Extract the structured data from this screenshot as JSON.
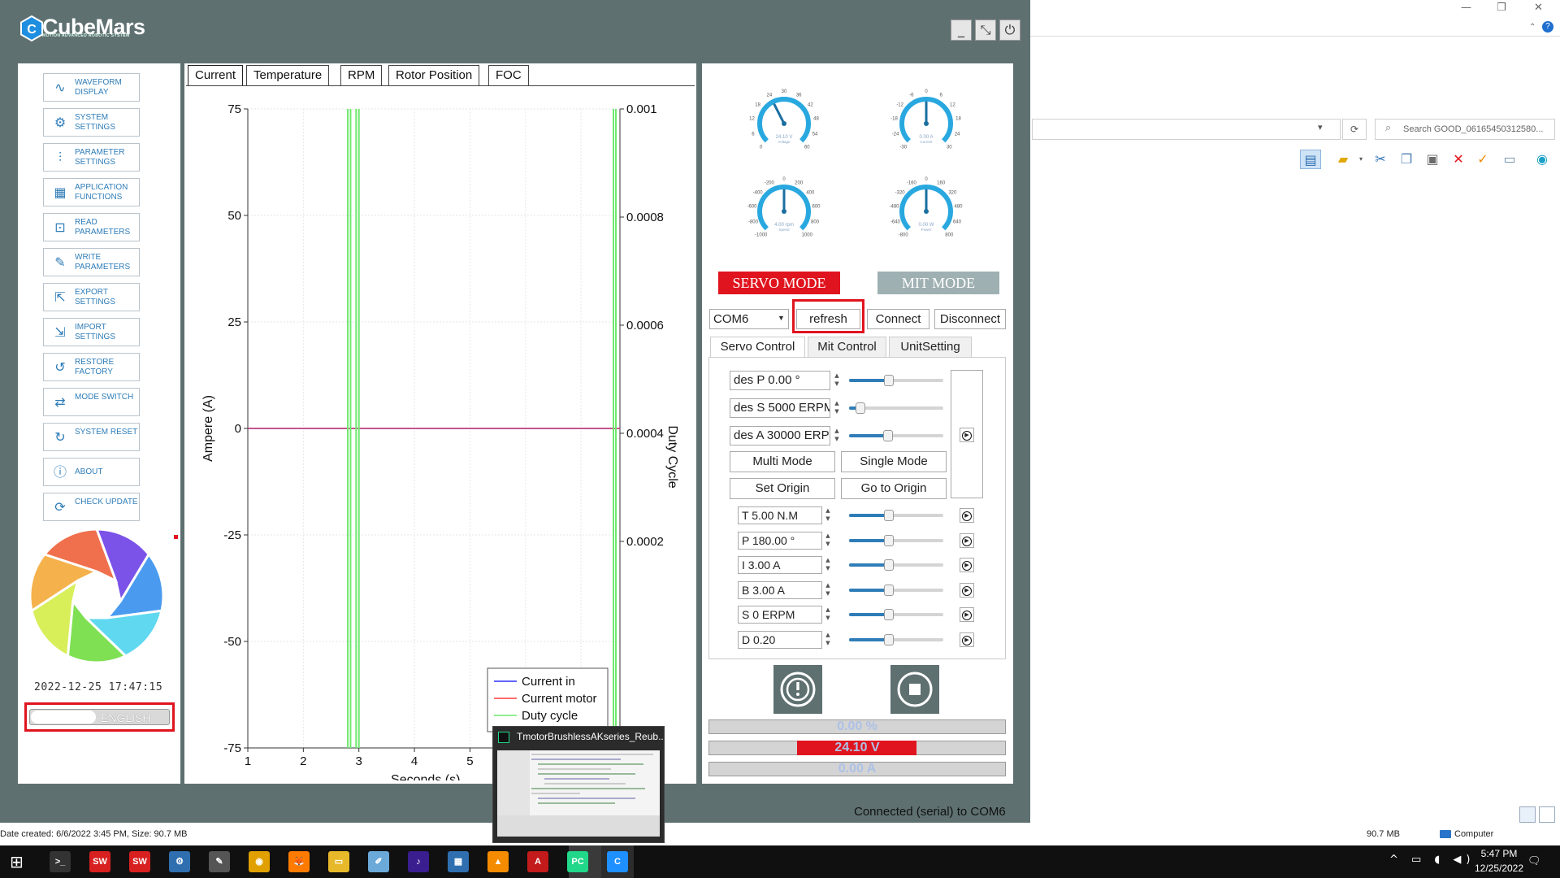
{
  "explorer": {
    "window_controls": [
      "—",
      "❐",
      "✕"
    ],
    "search_placeholder": "Search GOOD_06165450312580...",
    "refresh_glyph": "⟳",
    "status_left": "Date created: 6/6/2022 3:45 PM, Size: 90.7 MB",
    "status_size": "90.7 MB",
    "status_location": "Computer",
    "toolbar_icons": [
      "layout-pane-icon",
      "new-folder-icon",
      "cut-icon",
      "copy-icon",
      "paste-icon",
      "delete-icon",
      "checkmark-icon",
      "rename-icon",
      "globe-icon"
    ]
  },
  "app": {
    "logo_text": "CubeMars",
    "logo_subtitle": "MOTION ADVANCED ROBOTIC SYSTEM",
    "window_buttons": {
      "minimize": "_",
      "maximize": "⤡",
      "power": "⏻"
    },
    "sidebar": [
      {
        "label": "WAVEFORM DISPLAY",
        "icon": "waveform-icon",
        "glyph": "∿"
      },
      {
        "label": "SYSTEM SETTINGS",
        "icon": "gear-icon",
        "glyph": "⚙"
      },
      {
        "label": "PARAMETER SETTINGS",
        "icon": "sliders-icon",
        "glyph": "⫶"
      },
      {
        "label": "APPLICATION FUNCTIONS",
        "icon": "grid-icon",
        "glyph": "▦"
      },
      {
        "label": "READ PARAMETERS",
        "icon": "read-icon",
        "glyph": "⊡"
      },
      {
        "label": "WRITE PARAMETERS",
        "icon": "write-icon",
        "glyph": "✎"
      },
      {
        "label": "EXPORT SETTINGS",
        "icon": "export-icon",
        "glyph": "⇱"
      },
      {
        "label": "IMPORT SETTINGS",
        "icon": "import-icon",
        "glyph": "⇲"
      },
      {
        "label": "RESTORE FACTORY",
        "icon": "restore-icon",
        "glyph": "↺"
      },
      {
        "label": "MODE SWITCH",
        "icon": "switch-icon",
        "glyph": "⇄"
      },
      {
        "label": "SYSTEM RESET",
        "icon": "reset-icon",
        "glyph": "↻"
      },
      {
        "label": "ABOUT",
        "icon": "info-icon",
        "glyph": "ⓘ"
      },
      {
        "label": "CHECK UPDATE",
        "icon": "update-icon",
        "glyph": "⟳"
      }
    ],
    "datetime": "2022-12-25  17:47:15",
    "language": "ENGLISH",
    "tabs": [
      "Current",
      "Temperature",
      "RPM",
      "Rotor Position",
      "FOC"
    ],
    "active_tab": "Current",
    "gauges": [
      {
        "name": "voltage",
        "readout": "24.10 V",
        "caption": "Voltage",
        "ticks": [
          "0",
          "6",
          "12",
          "18",
          "24",
          "30",
          "36",
          "42",
          "48",
          "54",
          "60"
        ],
        "value_fraction": 0.4
      },
      {
        "name": "current",
        "readout": "0.00 A",
        "caption": "Current",
        "ticks": [
          "-30",
          "-24",
          "-18",
          "-12",
          "-6",
          "0",
          "6",
          "12",
          "18",
          "24",
          "30"
        ],
        "value_fraction": 0.5
      },
      {
        "name": "speed",
        "readout": "4.00 rpm",
        "caption": "Speed",
        "ticks": [
          "-1000",
          "-800",
          "-600",
          "-400",
          "-200",
          "0",
          "200",
          "400",
          "600",
          "800",
          "1000"
        ],
        "value_fraction": 0.5
      },
      {
        "name": "power",
        "readout": "0.00 W",
        "caption": "Power",
        "ticks": [
          "-800",
          "-640",
          "-480",
          "-320",
          "-160",
          "0",
          "160",
          "320",
          "480",
          "640",
          "800"
        ],
        "value_fraction": 0.5
      }
    ],
    "mode_buttons": {
      "servo": "SERVO MODE",
      "mit": "MIT MODE"
    },
    "port": {
      "selected": "COM6",
      "refresh": "refresh",
      "connect": "Connect",
      "disconnect": "Disconnect"
    },
    "control_tabs": [
      "Servo Control",
      "Mit Control",
      "UnitSetting"
    ],
    "servo": {
      "des_fields": [
        {
          "value": "des P 0.00 °",
          "slider": 0.42
        },
        {
          "value": "des S 5000 ERPM",
          "slider": 0.12
        },
        {
          "value": "des A 30000 ERPM",
          "slider": 0.41
        }
      ],
      "multi_mode": "Multi Mode",
      "single_mode": "Single Mode",
      "set_origin": "Set Origin",
      "go_to_origin": "Go to Origin",
      "params": [
        {
          "value": "T 5.00 N.M",
          "slider": 0.42
        },
        {
          "value": "P 180.00 °",
          "slider": 0.42
        },
        {
          "value": "I 3.00 A",
          "slider": 0.42
        },
        {
          "value": "B 3.00 A",
          "slider": 0.42
        },
        {
          "value": "S 0 ERPM",
          "slider": 0.42
        },
        {
          "value": "D 0.20",
          "slider": 0.42
        }
      ]
    },
    "bars": {
      "duty": "0.00 %",
      "voltage": "24.10 V",
      "current": "0.00 A"
    },
    "status": "Connected (serial) to COM6"
  },
  "chart_data": {
    "type": "line",
    "x": [
      1,
      2,
      3,
      4,
      5
    ],
    "xlabel": "Seconds (s)",
    "ylabel": "Ampere (A)",
    "ylabel_right": "Duty Cycle",
    "ylim": [
      -75,
      75
    ],
    "yticks": [
      "75",
      "50",
      "25",
      "0",
      "-25",
      "-50",
      "-75"
    ],
    "y2lim": [
      0,
      0.001
    ],
    "y2ticks": [
      "0.001",
      "0.0008",
      "0.0006",
      "0.0004",
      "0.0002"
    ],
    "xticks": [
      "1",
      "2",
      "3",
      "4",
      "5"
    ],
    "grid": true,
    "legend_position": "bottom-right",
    "series": [
      {
        "name": "Current in",
        "color": "#2b33ff",
        "values": [
          0,
          0,
          0,
          0,
          0
        ]
      },
      {
        "name": "Current motor",
        "color": "#ff3b3b",
        "values": [
          0,
          0,
          0,
          0,
          0
        ]
      },
      {
        "name": "Duty cycle",
        "color": "#6fe86f",
        "spikes_at_seconds": [
          2.8,
          2.85,
          2.95,
          3.0,
          7.6,
          7.65
        ]
      }
    ]
  },
  "taskbar": {
    "apps": [
      {
        "name": "terminal-app",
        "label": ">_",
        "color": "#333"
      },
      {
        "name": "solidworks-2020-app",
        "label": "SW",
        "color": "#d82020"
      },
      {
        "name": "solidworks-2022-app",
        "label": "SW",
        "color": "#d82020"
      },
      {
        "name": "network-app",
        "label": "⚙",
        "color": "#2f6fb0"
      },
      {
        "name": "tools-app",
        "label": "✎",
        "color": "#555"
      },
      {
        "name": "chrome-app",
        "label": "◉",
        "color": "#e0a000"
      },
      {
        "name": "firefox-app",
        "label": "🦊",
        "color": "#ff7b00"
      },
      {
        "name": "file-explorer-app",
        "label": "▭",
        "color": "#e7b92a"
      },
      {
        "name": "notepad-app",
        "label": "✐",
        "color": "#6aa9d8"
      },
      {
        "name": "amazon-music-app",
        "label": "♪",
        "color": "#3a1d8f"
      },
      {
        "name": "calculator-app",
        "label": "▦",
        "color": "#2f6fb0"
      },
      {
        "name": "vlc-app",
        "label": "▲",
        "color": "#f48b00"
      },
      {
        "name": "acrobat-app",
        "label": "A",
        "color": "#c31b1b"
      },
      {
        "name": "pycharm-app",
        "label": "PC",
        "color": "#21d789"
      },
      {
        "name": "cubemars-app",
        "label": "C",
        "color": "#1e90ff"
      }
    ],
    "time": "5:47 PM",
    "date": "12/25/2022",
    "tray": "^ ▭ ◖ ◀)",
    "preview_title": "TmotorBrushlessAKseries_Reub..."
  }
}
